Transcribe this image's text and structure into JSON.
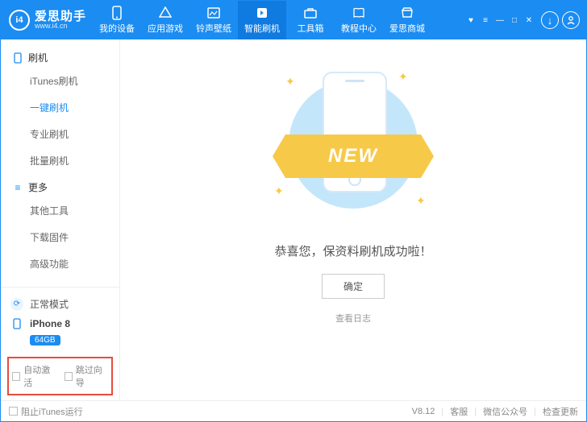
{
  "brand": {
    "title": "爱思助手",
    "subtitle": "www.i4.cn",
    "logo_text": "i4"
  },
  "nav": [
    {
      "label": "我的设备"
    },
    {
      "label": "应用游戏"
    },
    {
      "label": "铃声壁纸"
    },
    {
      "label": "智能刷机",
      "active": true
    },
    {
      "label": "工具箱"
    },
    {
      "label": "教程中心"
    },
    {
      "label": "爱思商城"
    }
  ],
  "sidebar": {
    "group1_label": "刷机",
    "group1_items": [
      {
        "label": "iTunes刷机"
      },
      {
        "label": "一键刷机",
        "active": true
      },
      {
        "label": "专业刷机"
      },
      {
        "label": "批量刷机"
      }
    ],
    "group2_label": "更多",
    "group2_items": [
      {
        "label": "其他工具"
      },
      {
        "label": "下载固件"
      },
      {
        "label": "高级功能"
      }
    ]
  },
  "device": {
    "mode": "正常模式",
    "name": "iPhone 8",
    "storage": "64GB"
  },
  "checks": {
    "auto_activate": "自动激活",
    "skip_guide": "跳过向导"
  },
  "main": {
    "ribbon": "NEW",
    "message": "恭喜您，保资料刷机成功啦！",
    "ok": "确定",
    "view_log": "查看日志"
  },
  "status": {
    "block_itunes": "阻止iTunes运行",
    "version": "V8.12",
    "support": "客服",
    "wechat": "微信公众号",
    "update": "检查更新"
  }
}
